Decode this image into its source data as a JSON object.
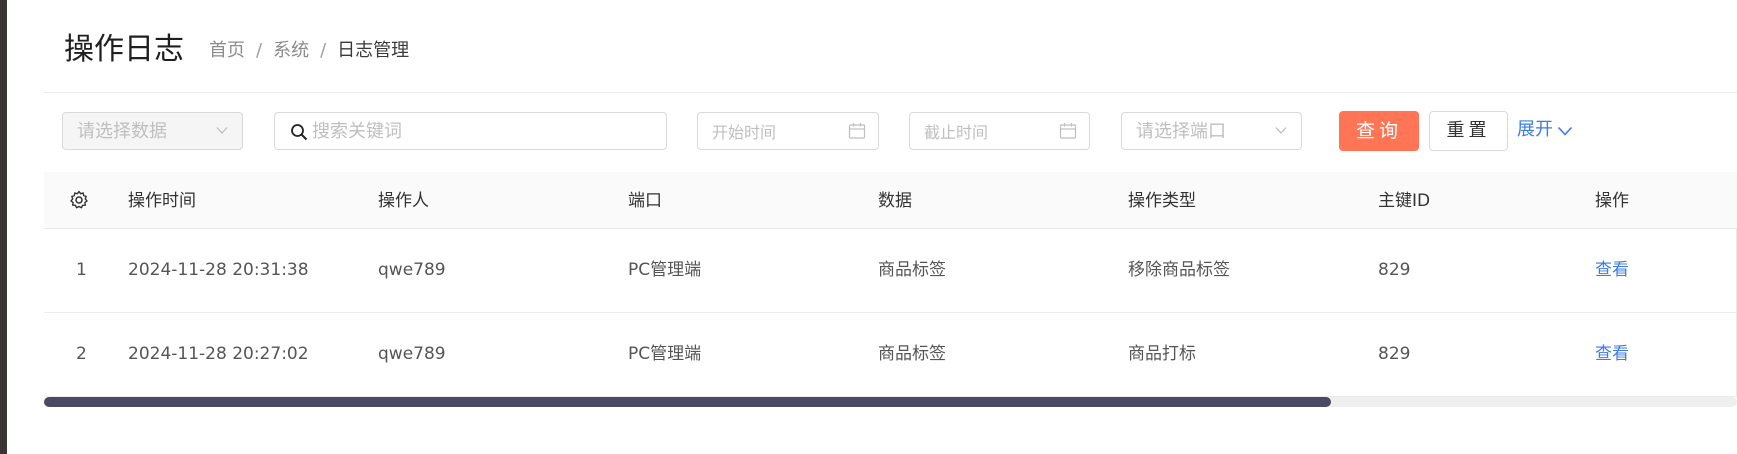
{
  "header": {
    "title": "操作日志",
    "breadcrumb": [
      "首页",
      "系统",
      "日志管理"
    ],
    "separator": "/"
  },
  "filters": {
    "data_select": {
      "placeholder": "请选择数据",
      "disabled": true
    },
    "search": {
      "placeholder": "搜索关键词",
      "value": ""
    },
    "start_time": {
      "placeholder": "开始时间"
    },
    "end_time": {
      "placeholder": "截止时间"
    },
    "port_select": {
      "placeholder": "请选择端口"
    },
    "query_label": "查询",
    "reset_label": "重置",
    "expand_label": "展开"
  },
  "table": {
    "columns": [
      "操作时间",
      "操作人",
      "端口",
      "数据",
      "操作类型",
      "主键ID",
      "操作"
    ],
    "rows": [
      {
        "index": "1",
        "time": "2024-11-28 20:31:38",
        "operator": "qwe789",
        "port": "PC管理端",
        "data": "商品标签",
        "op_type": "移除商品标签",
        "key_id": "829",
        "action": "查看"
      },
      {
        "index": "2",
        "time": "2024-11-28 20:27:02",
        "operator": "qwe789",
        "port": "PC管理端",
        "data": "商品标签",
        "op_type": "商品打标",
        "key_id": "829",
        "action": "查看"
      }
    ]
  },
  "scrollbar": {
    "position_fraction": 0.76
  },
  "colors": {
    "accent_orange": "#ff7556",
    "link_blue": "#3d7ce0",
    "scroll_thumb": "#4a4a64"
  },
  "icons": [
    "gear-icon",
    "search-icon",
    "calendar-icon",
    "chevron-down-icon"
  ]
}
